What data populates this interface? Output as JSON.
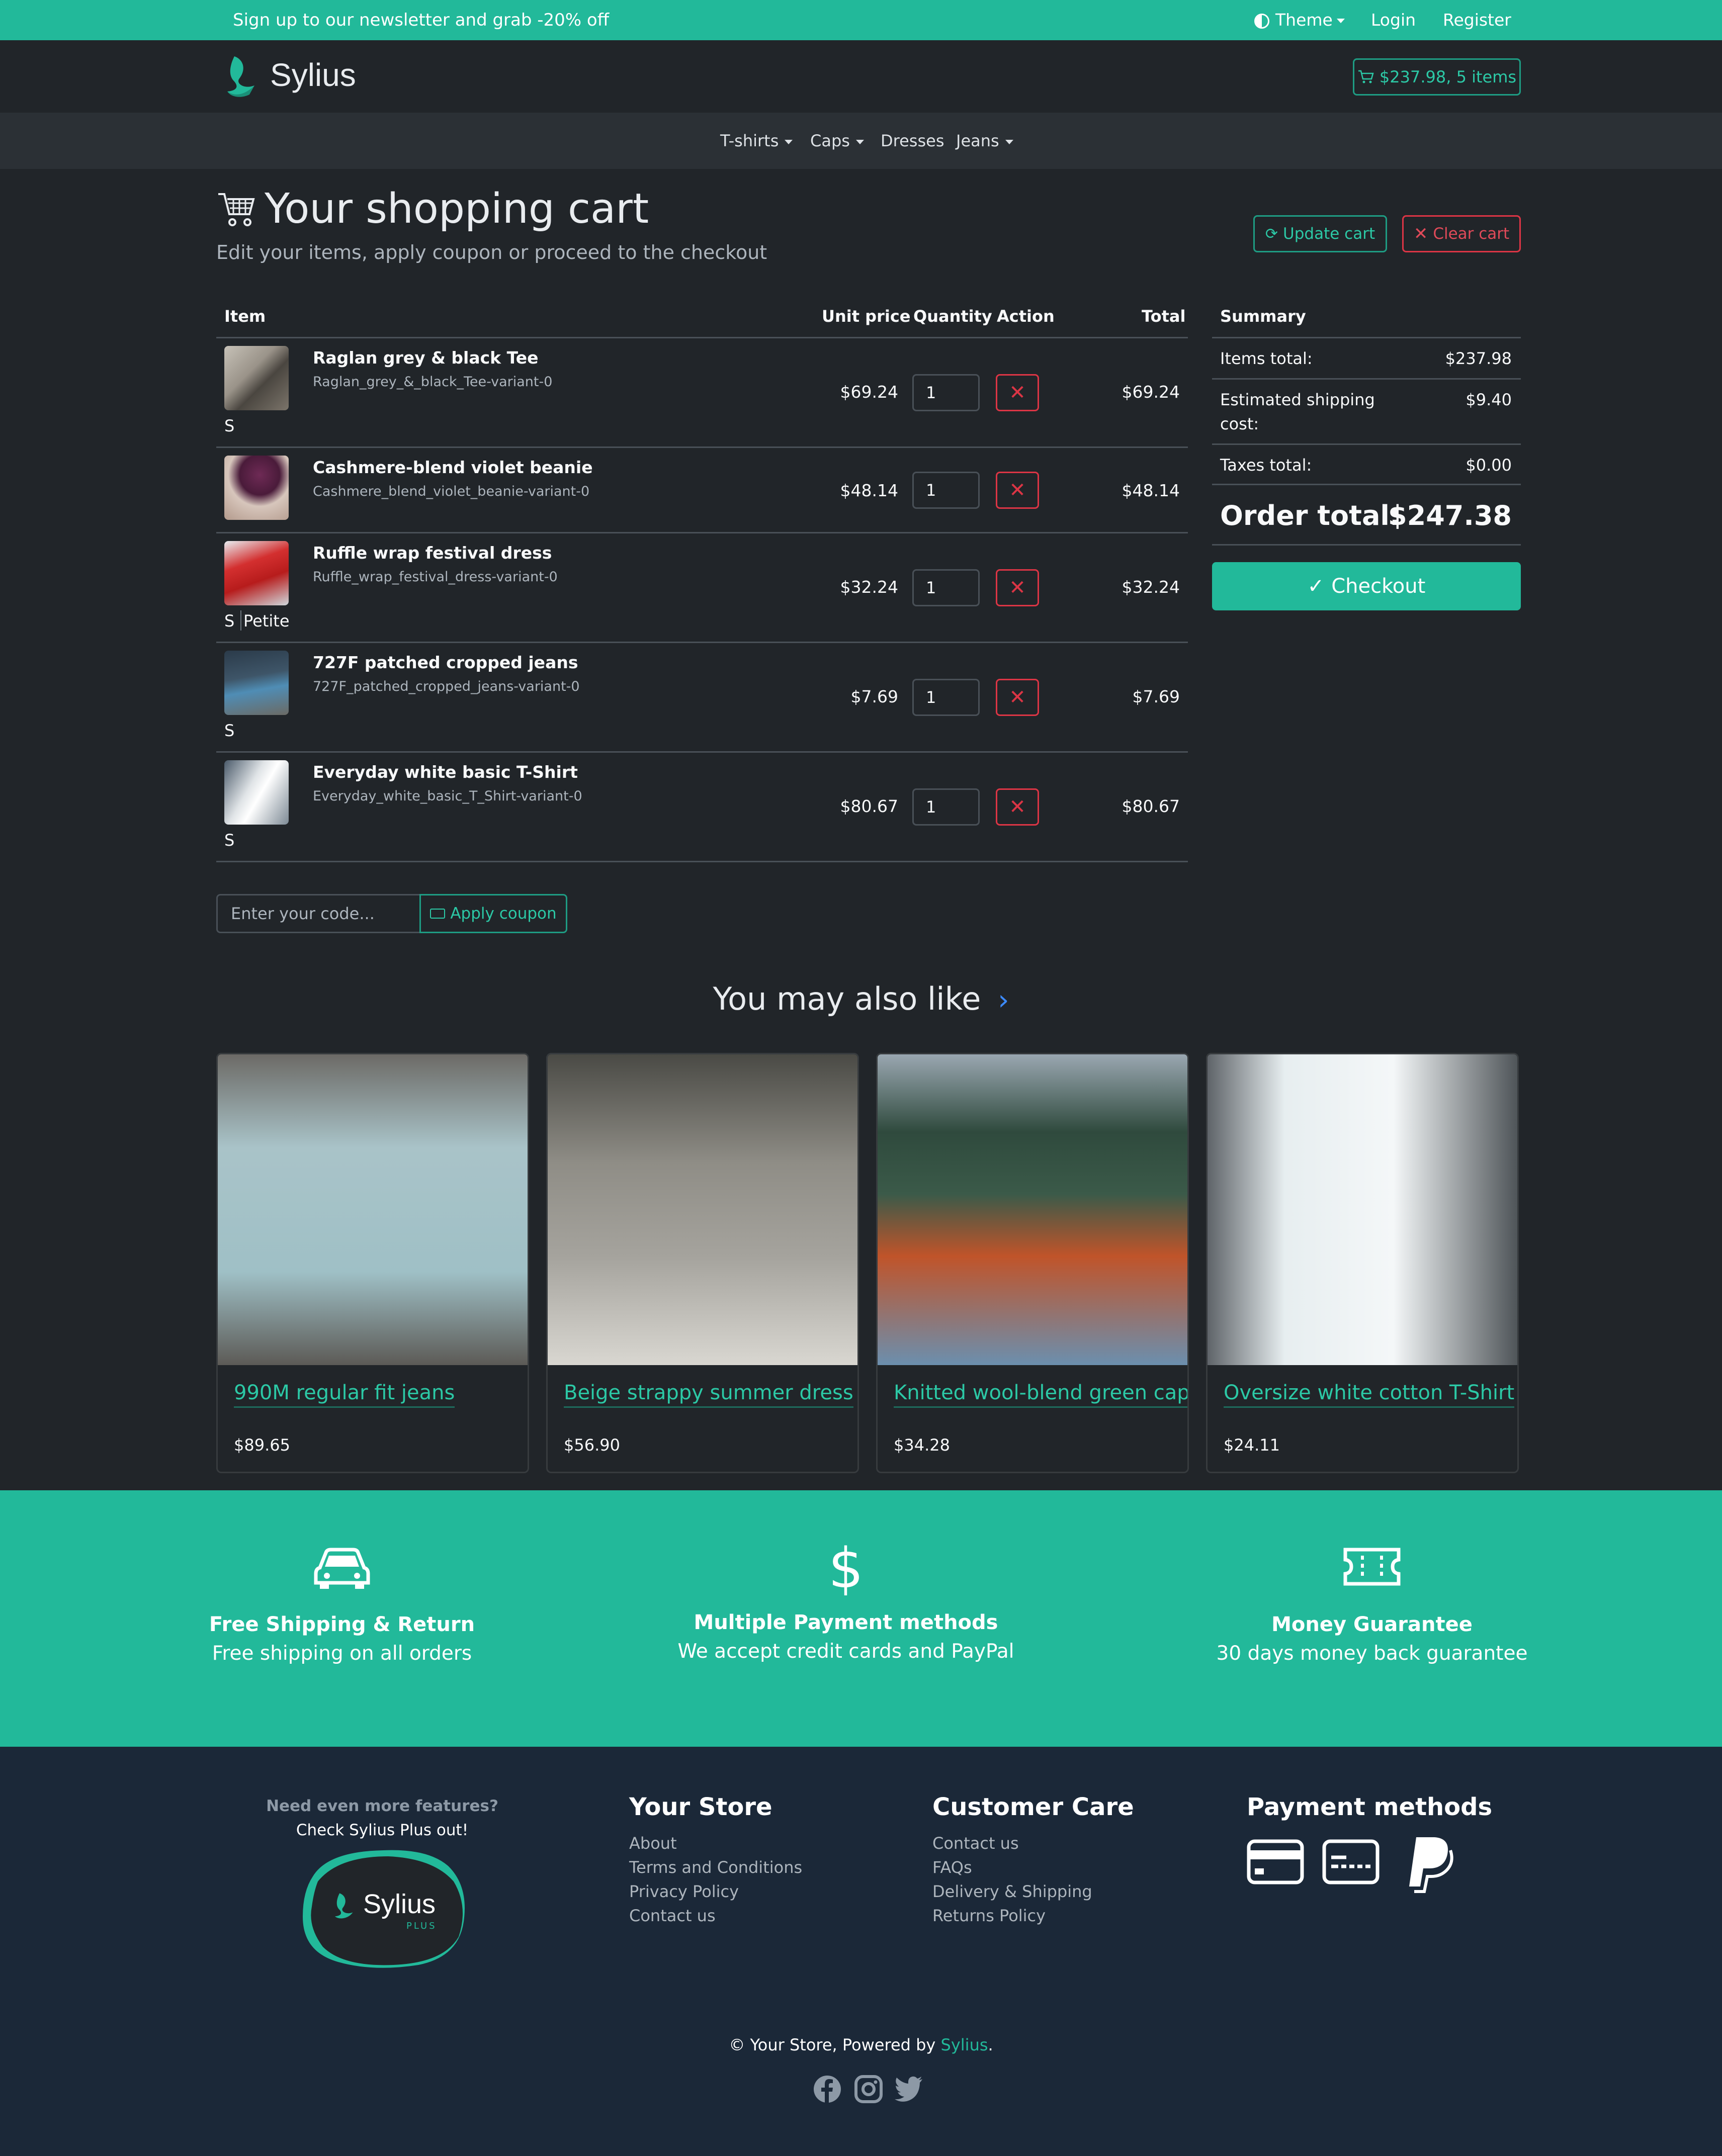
{
  "topbar": {
    "promo": "Sign up to our newsletter and grab -20% off",
    "theme": "Theme",
    "login": "Login",
    "register": "Register"
  },
  "header": {
    "logo": "Sylius",
    "cart_summary": "$237.98, 5 items"
  },
  "nav": {
    "items": [
      {
        "label": "T-shirts",
        "dropdown": true
      },
      {
        "label": "Caps",
        "dropdown": true
      },
      {
        "label": "Dresses",
        "dropdown": false
      },
      {
        "label": "Jeans",
        "dropdown": true
      }
    ]
  },
  "page": {
    "title": "Your shopping cart",
    "subtitle": "Edit your items, apply coupon or proceed to the checkout",
    "update_cart": "Update cart",
    "clear_cart": "Clear cart"
  },
  "table": {
    "headers": {
      "item": "Item",
      "unit_price": "Unit price",
      "quantity": "Quantity",
      "action": "Action",
      "total": "Total"
    },
    "rows": [
      {
        "name": "Raglan grey & black Tee",
        "code": "Raglan_grey_&_black_Tee-variant-0",
        "variant": "S",
        "variant2": "",
        "unit_price": "$69.24",
        "quantity": "1",
        "total": "$69.24"
      },
      {
        "name": "Cashmere-blend violet beanie",
        "code": "Cashmere_blend_violet_beanie-variant-0",
        "variant": "",
        "variant2": "",
        "unit_price": "$48.14",
        "quantity": "1",
        "total": "$48.14"
      },
      {
        "name": "Ruffle wrap festival dress",
        "code": "Ruffle_wrap_festival_dress-variant-0",
        "variant": "S",
        "variant2": "Petite",
        "unit_price": "$32.24",
        "quantity": "1",
        "total": "$32.24"
      },
      {
        "name": "727F patched cropped jeans",
        "code": "727F_patched_cropped_jeans-variant-0",
        "variant": "S",
        "variant2": "",
        "unit_price": "$7.69",
        "quantity": "1",
        "total": "$7.69"
      },
      {
        "name": "Everyday white basic T-Shirt",
        "code": "Everyday_white_basic_T_Shirt-variant-0",
        "variant": "S",
        "variant2": "",
        "unit_price": "$80.67",
        "quantity": "1",
        "total": "$80.67"
      }
    ]
  },
  "summary": {
    "title": "Summary",
    "items_total_label": "Items total:",
    "items_total": "$237.98",
    "shipping_label_1": "Estimated shipping",
    "shipping_label_2": "cost:",
    "shipping": "$9.40",
    "taxes_label": "Taxes total:",
    "taxes": "$0.00",
    "order_total_label": "Order total:",
    "order_total": "$247.38",
    "checkout": "Checkout"
  },
  "coupon": {
    "placeholder": "Enter your code...",
    "button": "Apply coupon"
  },
  "also_like": {
    "title": "You may also like",
    "products": [
      {
        "name": "990M regular fit jeans",
        "price": "$89.65"
      },
      {
        "name": "Beige strappy summer dress",
        "price": "$56.90"
      },
      {
        "name": "Knitted wool-blend green cap",
        "price": "$34.28"
      },
      {
        "name": "Oversize white cotton T-Shirt",
        "price": "$24.11"
      }
    ]
  },
  "features": [
    {
      "icon": "car-icon",
      "title": "Free Shipping & Return",
      "desc": "Free shipping on all orders"
    },
    {
      "icon": "dollar-icon",
      "title": "Multiple Payment methods",
      "desc": "We accept credit cards and PayPal"
    },
    {
      "icon": "ticket-icon",
      "title": "Money Guarantee",
      "desc": "30 days money back guarantee"
    }
  ],
  "footer": {
    "plus_line1": "Need even more features?",
    "plus_line2": "Check Sylius Plus out!",
    "plus_logo": "Sylius",
    "plus_logo_sub": "PLUS",
    "store_title": "Your Store",
    "store_links": [
      "About",
      "Terms and Conditions",
      "Privacy Policy",
      "Contact us"
    ],
    "care_title": "Customer Care",
    "care_links": [
      "Contact us",
      "FAQs",
      "Delivery & Shipping",
      "Returns Policy"
    ],
    "payment_title": "Payment methods",
    "copyright_prefix": "© Your Store, Powered by ",
    "copyright_link": "Sylius",
    "copyright_suffix": "."
  },
  "colors": {
    "accent": "#22b99a",
    "danger": "#dc3545",
    "background": "#212529",
    "footer": "#1b2838"
  }
}
